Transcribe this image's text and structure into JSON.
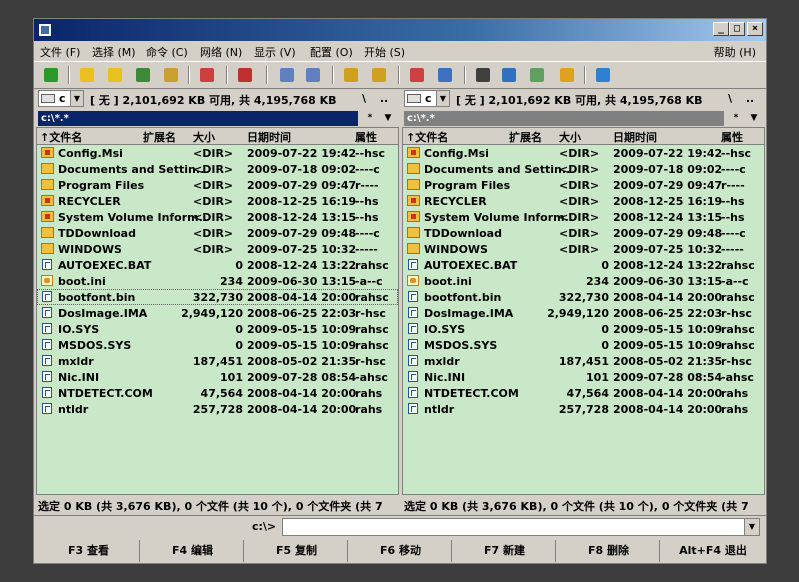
{
  "window": {
    "title": "",
    "controls": {
      "minimize": "_",
      "maximize": "□",
      "close": "×"
    }
  },
  "menu": [
    "文件 (F)",
    "选择 (M)",
    "命令 (C)",
    "网络 (N)",
    "显示 (V)",
    "配置 (O)",
    "开始 (S)"
  ],
  "help_menu": "帮助 (H)",
  "toolbar_icons": [
    {
      "name": "refresh-icon",
      "color": "#2a9a2a"
    },
    {
      "name": "brief-view-icon",
      "color": "#e8c020"
    },
    {
      "name": "full-view-icon",
      "color": "#e8c020"
    },
    {
      "name": "thumbnail-icon",
      "color": "#3a8a3a"
    },
    {
      "name": "tree-view-icon",
      "color": "#c8a030"
    },
    {
      "name": "invert-selection-icon",
      "color": "#c84040"
    },
    {
      "name": "unpack-icon",
      "color": "#c03030"
    },
    {
      "name": "back-icon",
      "color": "#6080c0"
    },
    {
      "name": "forward-icon",
      "color": "#6080c0"
    },
    {
      "name": "pack-icon",
      "color": "#d0a020"
    },
    {
      "name": "unpack-archive-icon",
      "color": "#d0a020"
    },
    {
      "name": "ftp-connect-icon",
      "color": "#d04040"
    },
    {
      "name": "ftp-disconnect-icon",
      "color": "#4070c0"
    },
    {
      "name": "search-icon",
      "color": "#404040"
    },
    {
      "name": "multi-rename-icon",
      "color": "#3070c0"
    },
    {
      "name": "sync-dirs-icon",
      "color": "#60a060"
    },
    {
      "name": "notepad-icon",
      "color": "#e0a020"
    },
    {
      "name": "open-folder-icon",
      "color": "#3080d0"
    }
  ],
  "panels": [
    {
      "id": "left",
      "drive": "c",
      "drive_info": "[ 无 ]  2,101,692 KB 可用, 共 4,195,768 KB",
      "root_btn": "\\",
      "up_btn": "..",
      "path": "c:\\*.*",
      "path_active": true,
      "path_star": "*",
      "path_drop": "▼",
      "columns": {
        "name": "↑文件名",
        "ext": "扩展名",
        "size": "大小",
        "date": "日期时间",
        "attr": "属性"
      },
      "rows": [
        {
          "icon": "folder-sys",
          "name": "Config.Msi",
          "size": "<DIR>",
          "date": "2009-07-22 19:42",
          "attr": "--hsc"
        },
        {
          "icon": "folder",
          "name": "Documents and Settin..",
          "size": "<DIR>",
          "date": "2009-07-18 09:02",
          "attr": "----c"
        },
        {
          "icon": "folder",
          "name": "Program Files",
          "size": "<DIR>",
          "date": "2009-07-29 09:47",
          "attr": "r----"
        },
        {
          "icon": "folder-sys",
          "name": "RECYCLER",
          "size": "<DIR>",
          "date": "2008-12-25 16:19",
          "attr": "--hs"
        },
        {
          "icon": "folder-sys",
          "name": "System Volume Inform..",
          "size": "<DIR>",
          "date": "2008-12-24 13:15",
          "attr": "--hs"
        },
        {
          "icon": "folder",
          "name": "TDDownload",
          "size": "<DIR>",
          "date": "2009-07-29 09:48",
          "attr": "----c"
        },
        {
          "icon": "folder",
          "name": "WINDOWS",
          "size": "<DIR>",
          "date": "2009-07-25 10:32",
          "attr": "-----"
        },
        {
          "icon": "file",
          "name": "AUTOEXEC.BAT",
          "size": "0",
          "date": "2008-12-24 13:22",
          "attr": "rahsc"
        },
        {
          "icon": "ini",
          "name": "boot.ini",
          "size": "234",
          "date": "2009-06-30 13:15",
          "attr": "-a--c"
        },
        {
          "icon": "file",
          "name": "bootfont.bin",
          "size": "322,730",
          "date": "2008-04-14 20:00",
          "attr": "rahsc"
        },
        {
          "icon": "file",
          "name": "DosImage.IMA",
          "size": "2,949,120",
          "date": "2008-06-25 22:03",
          "attr": "r-hsc"
        },
        {
          "icon": "file",
          "name": "IO.SYS",
          "size": "0",
          "date": "2009-05-15 10:09",
          "attr": "rahsc"
        },
        {
          "icon": "file",
          "name": "MSDOS.SYS",
          "size": "0",
          "date": "2009-05-15 10:09",
          "attr": "rahsc"
        },
        {
          "icon": "file",
          "name": "mxldr",
          "size": "187,451",
          "date": "2008-05-02 21:35",
          "attr": "r-hsc"
        },
        {
          "icon": "file",
          "name": "Nic.INI",
          "size": "101",
          "date": "2009-07-28 08:54",
          "attr": "-ahsc"
        },
        {
          "icon": "file",
          "name": "NTDETECT.COM",
          "size": "47,564",
          "date": "2008-04-14 20:00",
          "attr": "rahs"
        },
        {
          "icon": "file",
          "name": "ntldr",
          "size": "257,728",
          "date": "2008-04-14 20:00",
          "attr": "rahs"
        }
      ],
      "cursor_row": 9,
      "status": "选定 0 KB (共 3,676 KB), 0 个文件 (共 10 个), 0 个文件夹 (共 7"
    },
    {
      "id": "right",
      "drive": "c",
      "drive_info": "[ 无 ]  2,101,692 KB 可用, 共 4,195,768 KB",
      "root_btn": "\\",
      "up_btn": "..",
      "path": "c:\\*.*",
      "path_active": false,
      "path_star": "*",
      "path_drop": "▼",
      "columns": {
        "name": "↑文件名",
        "ext": "扩展名",
        "size": "大小",
        "date": "日期时间",
        "attr": "属性"
      },
      "rows": [
        {
          "icon": "folder-sys",
          "name": "Config.Msi",
          "size": "<DIR>",
          "date": "2009-07-22 19:42",
          "attr": "--hsc"
        },
        {
          "icon": "folder",
          "name": "Documents and Settin..",
          "size": "<DIR>",
          "date": "2009-07-18 09:02",
          "attr": "----c"
        },
        {
          "icon": "folder",
          "name": "Program Files",
          "size": "<DIR>",
          "date": "2009-07-29 09:47",
          "attr": "r----"
        },
        {
          "icon": "folder-sys",
          "name": "RECYCLER",
          "size": "<DIR>",
          "date": "2008-12-25 16:19",
          "attr": "--hs"
        },
        {
          "icon": "folder-sys",
          "name": "System Volume Inform..",
          "size": "<DIR>",
          "date": "2008-12-24 13:15",
          "attr": "--hs"
        },
        {
          "icon": "folder",
          "name": "TDDownload",
          "size": "<DIR>",
          "date": "2009-07-29 09:48",
          "attr": "----c"
        },
        {
          "icon": "folder",
          "name": "WINDOWS",
          "size": "<DIR>",
          "date": "2009-07-25 10:32",
          "attr": "-----"
        },
        {
          "icon": "file",
          "name": "AUTOEXEC.BAT",
          "size": "0",
          "date": "2008-12-24 13:22",
          "attr": "rahsc"
        },
        {
          "icon": "ini",
          "name": "boot.ini",
          "size": "234",
          "date": "2009-06-30 13:15",
          "attr": "-a--c"
        },
        {
          "icon": "file",
          "name": "bootfont.bin",
          "size": "322,730",
          "date": "2008-04-14 20:00",
          "attr": "rahsc"
        },
        {
          "icon": "file",
          "name": "DosImage.IMA",
          "size": "2,949,120",
          "date": "2008-06-25 22:03",
          "attr": "r-hsc"
        },
        {
          "icon": "file",
          "name": "IO.SYS",
          "size": "0",
          "date": "2009-05-15 10:09",
          "attr": "rahsc"
        },
        {
          "icon": "file",
          "name": "MSDOS.SYS",
          "size": "0",
          "date": "2009-05-15 10:09",
          "attr": "rahsc"
        },
        {
          "icon": "file",
          "name": "mxldr",
          "size": "187,451",
          "date": "2008-05-02 21:35",
          "attr": "r-hsc"
        },
        {
          "icon": "file",
          "name": "Nic.INI",
          "size": "101",
          "date": "2009-07-28 08:54",
          "attr": "-ahsc"
        },
        {
          "icon": "file",
          "name": "NTDETECT.COM",
          "size": "47,564",
          "date": "2008-04-14 20:00",
          "attr": "rahs"
        },
        {
          "icon": "file",
          "name": "ntldr",
          "size": "257,728",
          "date": "2008-04-14 20:00",
          "attr": "rahs"
        }
      ],
      "cursor_row": null,
      "status": "选定 0 KB (共 3,676 KB), 0 个文件 (共 10 个), 0 个文件夹 (共 7"
    }
  ],
  "command": {
    "prompt": "c:\\>",
    "value": "",
    "drop": "▼"
  },
  "fkeys": [
    "F3 查看",
    "F4 编辑",
    "F5 复制",
    "F6 移动",
    "F7 新建",
    "F8 删除",
    "Alt+F4 退出"
  ],
  "colors": {
    "panel_bg": "#c8e8c8",
    "active_path": "#0a246a",
    "inactive_path": "#808080",
    "chrome": "#d4d0c8"
  }
}
